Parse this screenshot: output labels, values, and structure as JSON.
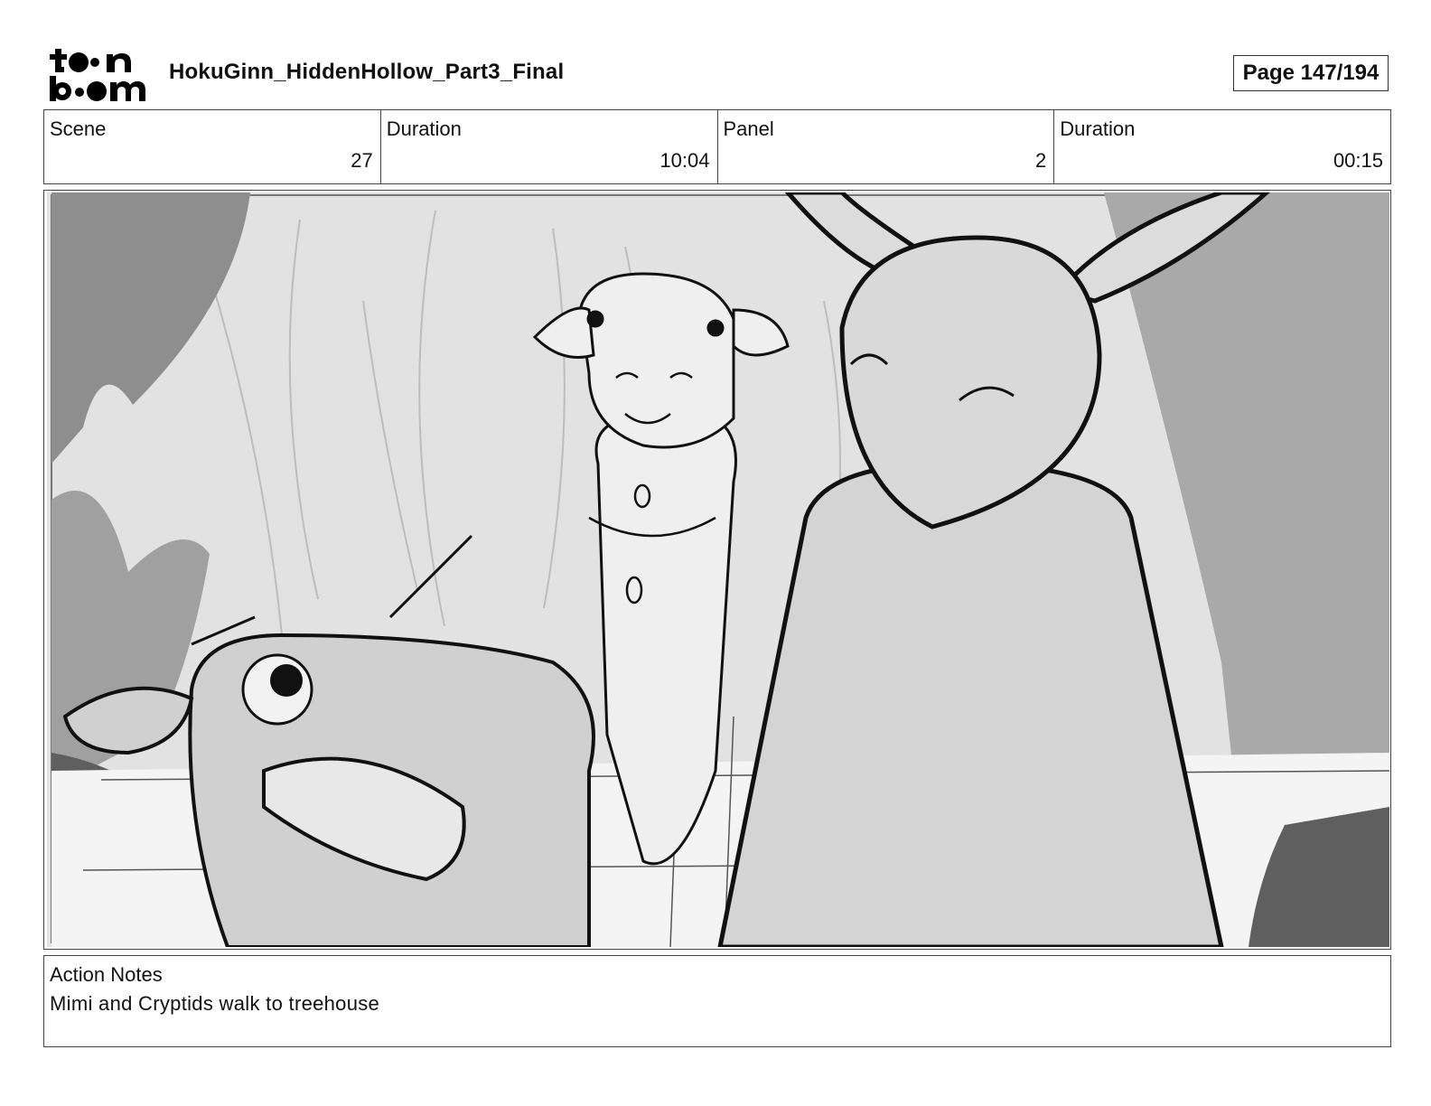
{
  "header": {
    "logo_text": "toon boom",
    "project_title": "HokuGinn_HiddenHollow_Part3_Final",
    "page_label": "Page 147/194"
  },
  "info": {
    "scene_label": "Scene",
    "scene_value": "27",
    "scene_duration_label": "Duration",
    "scene_duration_value": "10:04",
    "panel_label": "Panel",
    "panel_value": "2",
    "panel_duration_label": "Duration",
    "panel_duration_value": "00:15"
  },
  "panel_image": {
    "icon": "storyboard-sketch",
    "style": "grayscale pencil sketch"
  },
  "notes": {
    "label": "Action Notes",
    "text": "Mimi and Cryptids walk to treehouse"
  }
}
